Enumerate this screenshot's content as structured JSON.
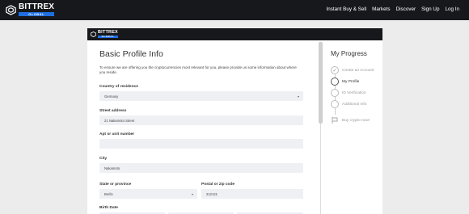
{
  "brand": {
    "word": "BITTREX",
    "sub": "GLOBAL",
    "accent": "#1f6fe0"
  },
  "nav": {
    "items": [
      "Instant Buy & Sell",
      "Markets",
      "Discover",
      "Sign Up",
      "Log In"
    ]
  },
  "form": {
    "title": "Basic Profile Info",
    "description": "To ensure we are offering you the cryptocurrencies most relevant for you, please provide us some information about where you reside.",
    "country_label": "Country of residence",
    "country_value": "Germany",
    "street_label": "Street address",
    "street_value": "21 Nakamoto Street",
    "apt_label": "Apt or unit number",
    "apt_value": "",
    "city_label": "City",
    "city_value": "Nakamoto",
    "state_label": "State or province",
    "state_value": "Berlin",
    "postal_label": "Postal or zip code",
    "postal_value": "212121",
    "birth_label": "Birth Date"
  },
  "progress": {
    "title": "My Progress",
    "steps": [
      {
        "label": "Create an Account",
        "status": "done"
      },
      {
        "label": "My Profile",
        "status": "active"
      },
      {
        "label": "ID Verification",
        "status": "pending"
      },
      {
        "label": "Additional Info",
        "status": "pending"
      },
      {
        "label": "Buy crypto now!",
        "status": "pending"
      }
    ]
  }
}
